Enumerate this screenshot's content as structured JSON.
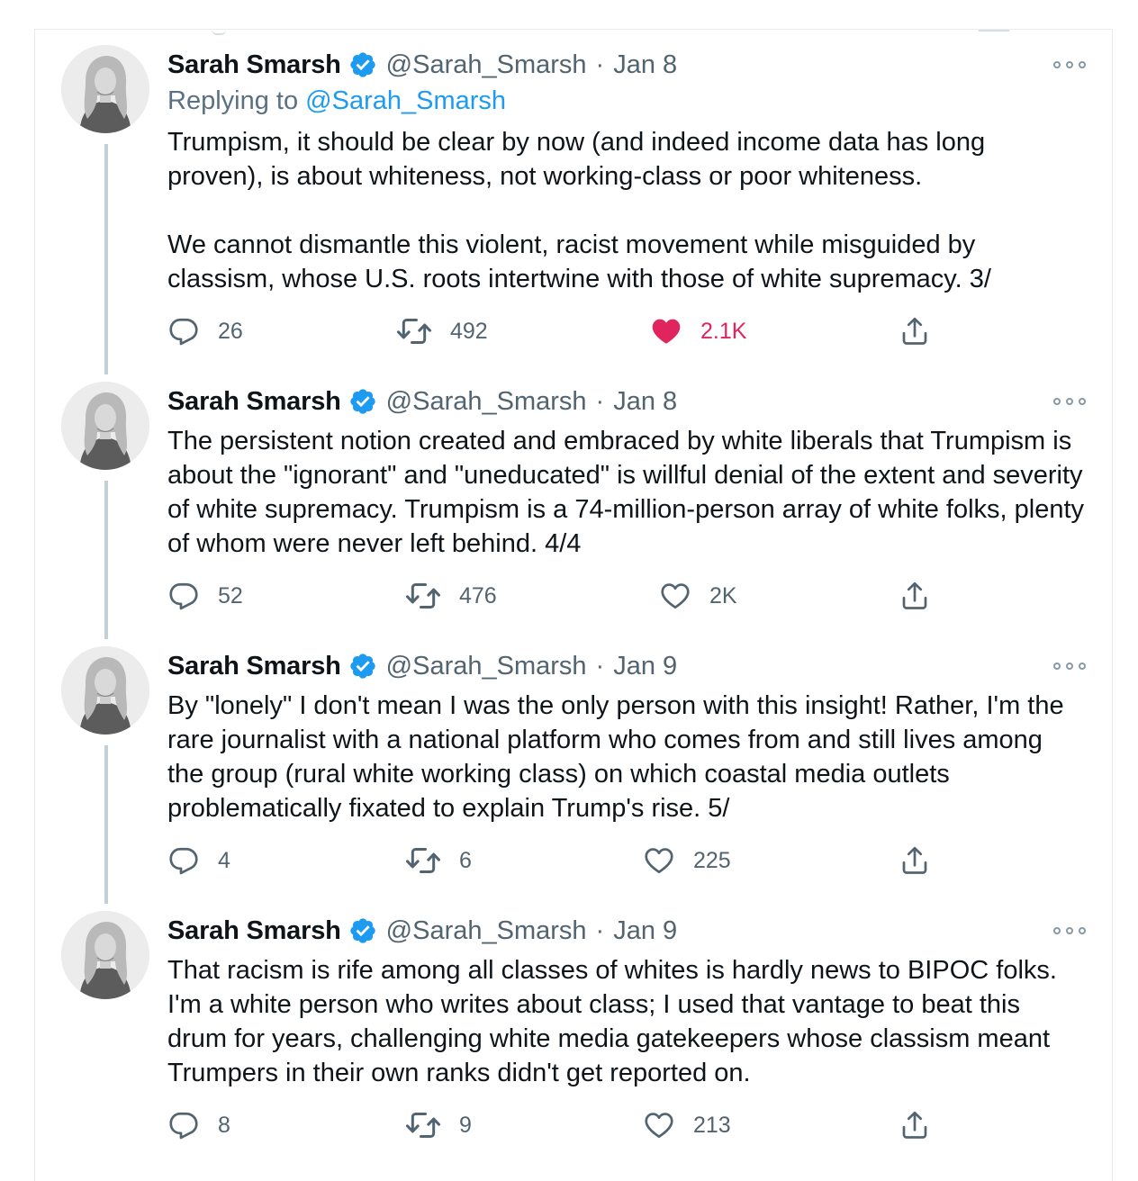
{
  "tweets": [
    {
      "name": "Sarah Smarsh",
      "handle": "@Sarah_Smarsh",
      "separator": "·",
      "date": "Jan 8",
      "replying_prefix": "Replying to",
      "replying_to": "@Sarah_Smarsh",
      "text": "Trumpism, it should be clear by now (and indeed income data has long proven), is about whiteness, not working-class or poor whiteness.\n\nWe cannot dismantle this violent, racist movement while misguided by classism, whose U.S. roots intertwine with those of white supremacy. 3/",
      "replies": "26",
      "retweets": "492",
      "likes": "2.1K",
      "liked": true
    },
    {
      "name": "Sarah Smarsh",
      "handle": "@Sarah_Smarsh",
      "separator": "·",
      "date": "Jan 8",
      "text": "The persistent notion created and embraced by white liberals that Trumpism is about the \"ignorant\" and \"uneducated\" is willful denial of the extent and severity of white supremacy. Trumpism is a 74-million-person array of white folks, plenty of whom were never left behind. 4/4",
      "replies": "52",
      "retweets": "476",
      "likes": "2K",
      "liked": false
    },
    {
      "name": "Sarah Smarsh",
      "handle": "@Sarah_Smarsh",
      "separator": "·",
      "date": "Jan 9",
      "text": "By \"lonely\" I don't mean I was the only person with this insight! Rather, I'm the rare journalist with a national platform who comes from and still lives among the group (rural white working class) on which coastal media outlets problematically fixated to explain Trump's rise. 5/",
      "replies": "4",
      "retweets": "6",
      "likes": "225",
      "liked": false
    },
    {
      "name": "Sarah Smarsh",
      "handle": "@Sarah_Smarsh",
      "separator": "·",
      "date": "Jan 9",
      "text": "That racism is rife among all classes of whites is hardly news to BIPOC folks. I'm a white person who writes about class; I used that vantage to beat this drum for years, challenging white media gatekeepers whose classism meant Trumpers in their own ranks didn't get reported on.",
      "replies": "8",
      "retweets": "9",
      "likes": "213",
      "liked": false
    }
  ],
  "colors": {
    "verified": "#1d9bf0",
    "like_active": "#e0245e",
    "secondary_text": "#536471",
    "thread_line": "#c4cfd6"
  },
  "icons": [
    "verified-badge-icon",
    "more-options-icon",
    "reply-icon",
    "retweet-icon",
    "like-icon",
    "share-icon"
  ]
}
